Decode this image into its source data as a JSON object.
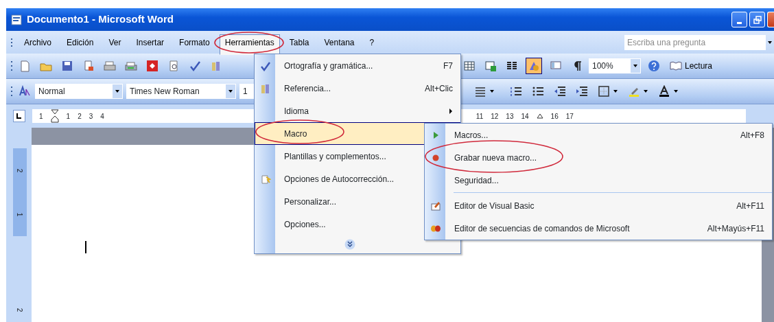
{
  "window": {
    "title": "Documento1 - Microsoft Word"
  },
  "menu_bar": {
    "items": [
      {
        "label": "Archivo",
        "selected": false,
        "circled": false
      },
      {
        "label": "Edición",
        "selected": false,
        "circled": false
      },
      {
        "label": "Ver",
        "selected": false,
        "circled": false
      },
      {
        "label": "Insertar",
        "selected": false,
        "circled": false
      },
      {
        "label": "Formato",
        "selected": false,
        "circled": false
      },
      {
        "label": "Herramientas",
        "selected": true,
        "circled": true
      },
      {
        "label": "Tabla",
        "selected": false,
        "circled": false
      },
      {
        "label": "Ventana",
        "selected": false,
        "circled": false
      },
      {
        "label": "?",
        "selected": false,
        "circled": false
      }
    ],
    "help_search": {
      "placeholder": "Escriba una pregunta"
    }
  },
  "standard_toolbar": {
    "zoom": "100%",
    "reading_button": "Lectura"
  },
  "formatting_toolbar": {
    "style": "Normal",
    "font": "Times New Roman",
    "size": "1"
  },
  "ruler": {
    "left_labels": [
      "1",
      "1",
      "2",
      "3",
      "4"
    ],
    "right_labels": [
      "11",
      "12",
      "13",
      "14",
      "16",
      "17"
    ]
  },
  "vertical_ruler": {
    "labels": [
      "2",
      "1",
      "2"
    ]
  },
  "tools_menu": {
    "items": [
      {
        "kind": "command",
        "label": "Ortografía y gramática...",
        "shortcut": "F7",
        "selected": false,
        "circled": false
      },
      {
        "kind": "command",
        "label": "Referencia...",
        "shortcut": "Alt+Clic",
        "selected": false,
        "circled": false
      },
      {
        "kind": "submenu",
        "label": "Idioma",
        "selected": false,
        "circled": false
      },
      {
        "kind": "submenu",
        "label": "Macro",
        "selected": true,
        "circled": true
      },
      {
        "kind": "command",
        "label": "Plantillas y complementos...",
        "selected": false,
        "circled": false
      },
      {
        "kind": "command",
        "label": "Opciones de Autocorrección...",
        "selected": false,
        "circled": false
      },
      {
        "kind": "command",
        "label": "Personalizar...",
        "selected": false,
        "circled": false
      },
      {
        "kind": "command",
        "label": "Opciones...",
        "selected": false,
        "circled": false
      },
      {
        "kind": "expand"
      }
    ]
  },
  "macro_submenu": {
    "items": [
      {
        "kind": "command",
        "label": "Macros...",
        "shortcut": "Alt+F8",
        "selected": false,
        "circled": false
      },
      {
        "kind": "command",
        "label": "Grabar nueva macro...",
        "selected": false,
        "circled": true
      },
      {
        "kind": "command",
        "label": "Seguridad...",
        "selected": false,
        "circled": false
      },
      {
        "kind": "separator"
      },
      {
        "kind": "command",
        "label": "Editor de Visual Basic",
        "shortcut": "Alt+F11",
        "selected": false,
        "circled": false
      },
      {
        "kind": "command",
        "label": "Editor de secuencias de comandos de Microsoft",
        "shortcut": "Alt+Mayús+F11",
        "selected": false,
        "circled": false
      }
    ]
  }
}
